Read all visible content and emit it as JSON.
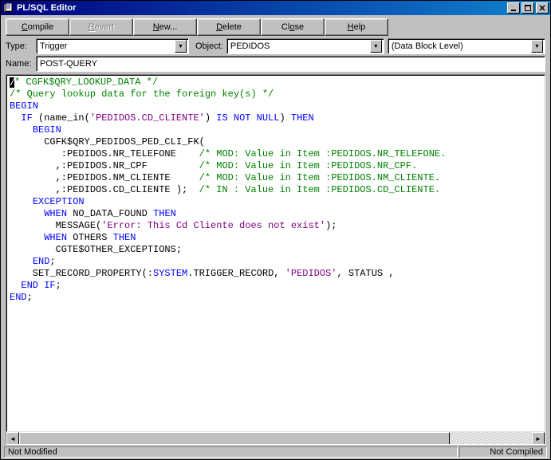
{
  "titlebar": {
    "title": "PL/SQL Editor"
  },
  "toolbar": {
    "compile": "Compile",
    "revert": "Revert",
    "new": "New...",
    "delete": "Delete",
    "close": "Close",
    "help": "Help"
  },
  "fields": {
    "type_label": "Type:",
    "type_value": "Trigger",
    "object_label": "Object:",
    "object_value": "PEDIDOS",
    "level_value": "(Data Block Level)",
    "name_label": "Name:",
    "name_value": "POST-QUERY"
  },
  "code": {
    "l1a": "/",
    "l1b": "* CGFK$QRY_LOOKUP_DATA */",
    "l2": "/* Query lookup data for the foreign key(s) */",
    "l3": "BEGIN",
    "l4a": "IF",
    "l4b": " (name_in(",
    "l4c": "'PEDIDOS.CD_CLIENTE'",
    "l4d": ") ",
    "l4e": "IS NOT NULL",
    "l4f": ") ",
    "l4g": "THEN",
    "l5": "BEGIN",
    "l6": "      CGFK$QRY_PEDIDOS_PED_CLI_FK(",
    "l7a": "         :PEDIDOS.NR_TELEFONE    ",
    "l7b": "/* MOD: Value in Item :PEDIDOS.NR_TELEFONE.",
    "l8a": "        ,:PEDIDOS.NR_CPF         ",
    "l8b": "/* MOD: Value in Item :PEDIDOS.NR_CPF.",
    "l9a": "        ,:PEDIDOS.NM_CLIENTE     ",
    "l9b": "/* MOD: Value in Item :PEDIDOS.NM_CLIENTE.",
    "l10a": "        ,:PEDIDOS.CD_CLIENTE );  ",
    "l10b": "/* IN : Value in Item :PEDIDOS.CD_CLIENTE.",
    "l11": "EXCEPTION",
    "l12a": "WHEN",
    "l12b": " NO_DATA_FOUND ",
    "l12c": "THEN",
    "l13a": "        MESSAGE(",
    "l13b": "'Error: This Cd Cliente does not exist'",
    "l13c": ");",
    "l14a": "WHEN",
    "l14b": " OTHERS ",
    "l14c": "THEN",
    "l15": "        CGTE$OTHER_EXCEPTIONS;",
    "l16a": "END",
    "l16b": ";",
    "l17a": "    SET_RECORD_PROPERTY(:",
    "l17b": "SYSTEM",
    "l17c": ".TRIGGER_RECORD, ",
    "l17d": "'PEDIDOS'",
    "l17e": ", STATUS ,",
    "l18a": "END",
    "l18b": " ",
    "l18c": "IF",
    "l18d": ";",
    "l19a": "END",
    "l19b": ";"
  },
  "status": {
    "modified": "Not Modified",
    "compiled": "Not Compiled"
  }
}
